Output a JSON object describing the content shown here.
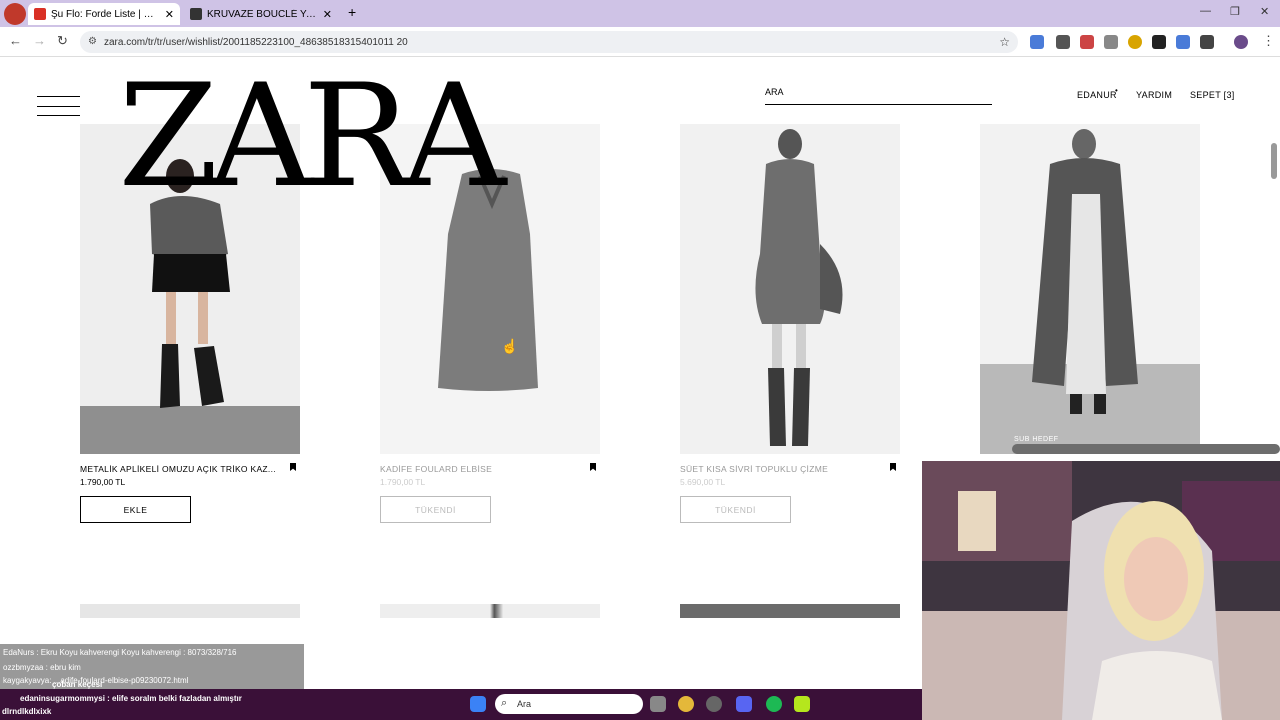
{
  "browser": {
    "tabs": [
      {
        "title": "Şu Flo: Forde Liste | ZARA Türkiye",
        "favicon_color": "#d93025"
      },
      {
        "title": "KRUVAZE BOUCLÉ YARIM KABAN",
        "favicon_color": "#333333"
      }
    ],
    "new_tab": "+",
    "url": "zara.com/tr/tr/user/wishlist/2001185223100_48638518315401011 20"
  },
  "header": {
    "logo": "ZARA",
    "search_placeholder": "ARA",
    "user": "EDANUR",
    "help": "YARDIM",
    "cart": "SEPET [3]"
  },
  "products": [
    {
      "name": "METALİK APLİKELİ OMUZU AÇIK TRİKO KAZ...",
      "price": "1.790,00 TL",
      "button": "EKLE",
      "available": true
    },
    {
      "name": "KADİFE FOULARD ELBİSE",
      "price": "1.790,00 TL",
      "button": "TÜKENDİ",
      "available": false
    },
    {
      "name": "SÜET KISA SİVRİ TOPUKLU ÇİZME",
      "price": "5.690,00 TL",
      "button": "TÜKENDİ",
      "available": false
    }
  ],
  "overlay": {
    "sub_label": "SUB HEDEF",
    "chat": [
      "EdaNurs : Ekru Koyu kahverengi Koyu kahverengi : 8073/328/716",
      "ozzbmyzaa : ebru kim",
      "kaygakyavya: ...adife-foulard-elbise-p09230072.html",
      "çoban keçesi",
      "edaninsugarmommysi : elife soralm belki fazladan almıştır",
      "dlrndlkdlxixk"
    ],
    "taskbar_search": "Ara"
  }
}
